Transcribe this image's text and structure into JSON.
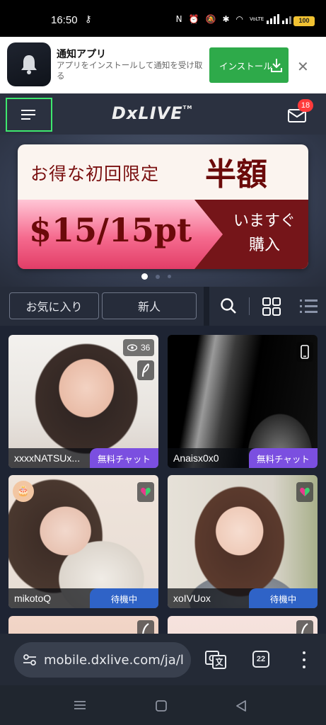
{
  "status_bar": {
    "time": "16:50",
    "battery": "100",
    "signal_label": "VoLTE"
  },
  "install_banner": {
    "title": "通知アプリ",
    "description": "アプリをインストールして通知を受け取る",
    "install_label": "インストール",
    "close_label": "✕"
  },
  "header": {
    "logo": "DxLIVE",
    "logo_tm": "TM",
    "mail_badge": "18"
  },
  "promo": {
    "line1": "お得な初回限定",
    "line1_big": "半額",
    "price": "$15/15pt",
    "buy_line1": "いますぐ",
    "buy_line2": "購入"
  },
  "carousel": {
    "count": 3,
    "active": 0
  },
  "filters": {
    "tab_favorites": "お気に入り",
    "tab_new": "新人"
  },
  "performers": [
    {
      "name": "xxxxNATSUx...",
      "status": "無料チャット",
      "viewers": "36"
    },
    {
      "name": "Anaisx0x0",
      "status": "無料チャット"
    },
    {
      "name": "mikotoQ",
      "status": "待機中"
    },
    {
      "name": "xoIVUox",
      "status": "待機中"
    }
  ],
  "browser": {
    "url": "mobile.dxlive.com/ja/l",
    "tab_count": "22"
  },
  "colors": {
    "install_green": "#2eaa4a",
    "free_chat_purple": "#7b4fe0",
    "waiting_blue": "#2f63c7",
    "highlight_green": "#3ee86e",
    "badge_red": "#ff3b3b"
  }
}
